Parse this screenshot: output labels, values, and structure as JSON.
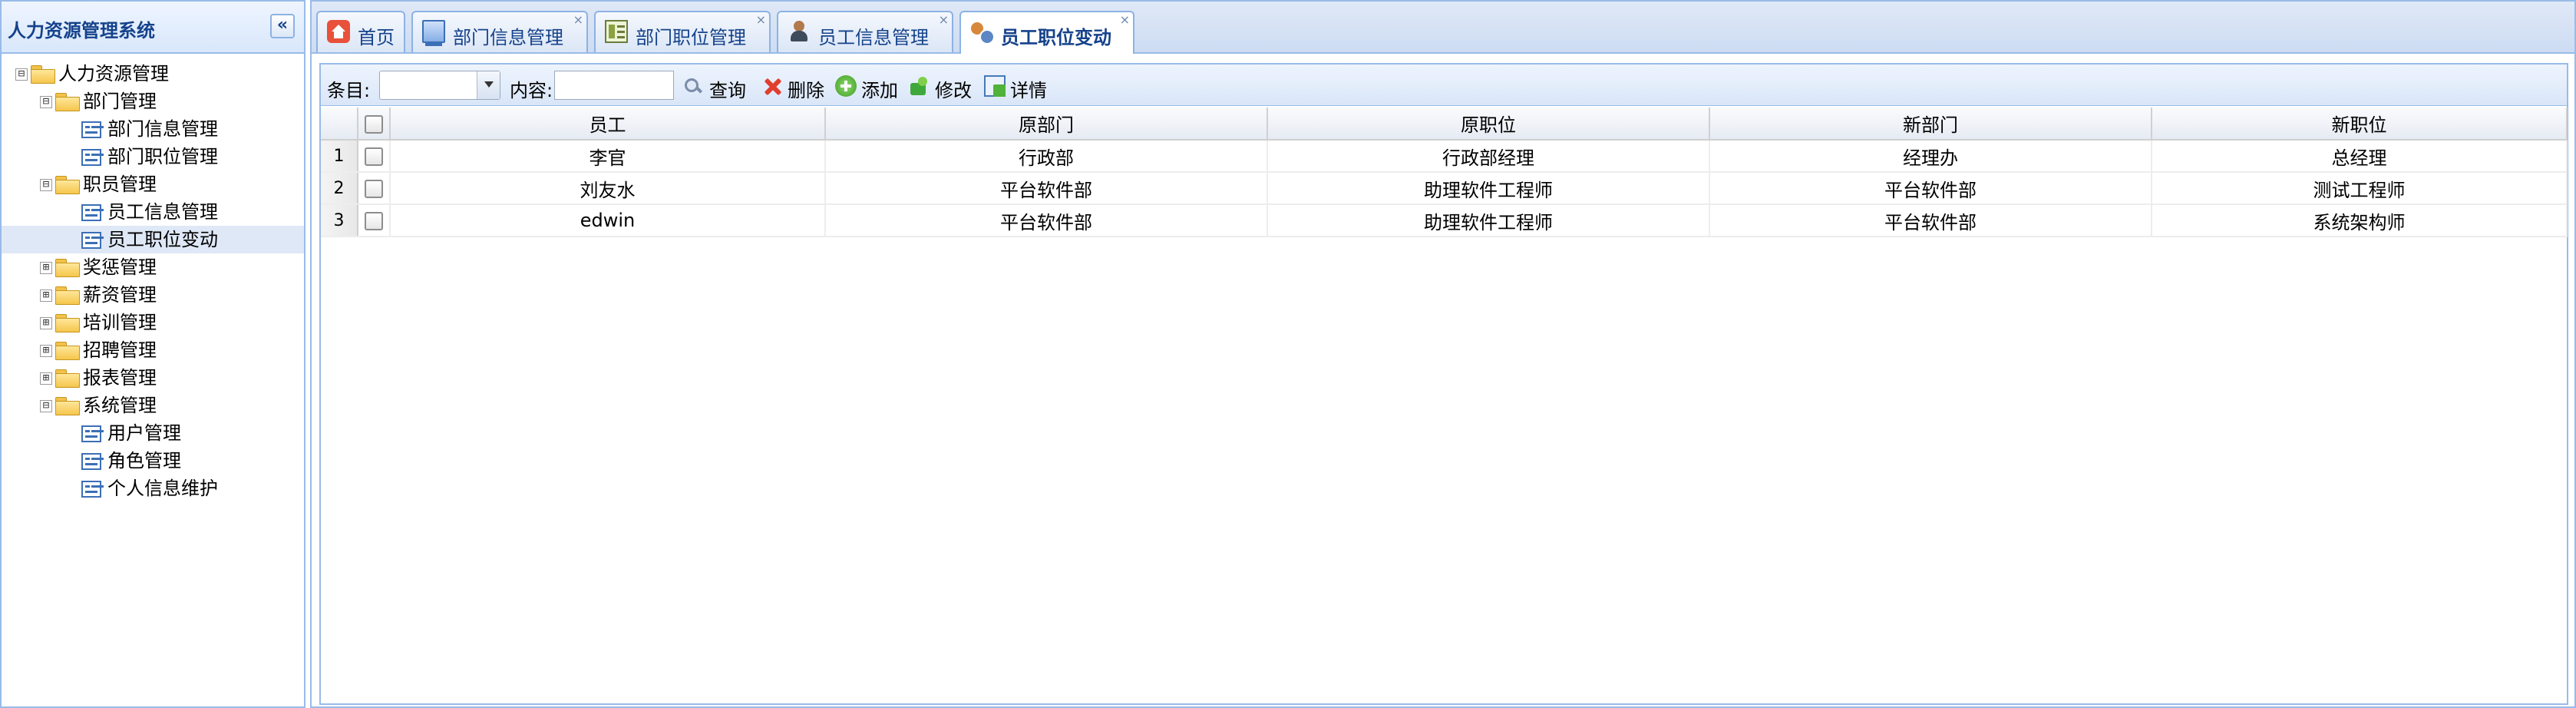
{
  "west": {
    "title": "人力资源管理系统",
    "collapse_glyph": "«"
  },
  "tree": [
    {
      "label": "人力资源管理",
      "toggle": "⊟",
      "type": "folder",
      "level": 0
    },
    {
      "label": "部门管理",
      "toggle": "⊟",
      "type": "folder",
      "level": 1
    },
    {
      "label": "部门信息管理",
      "type": "leaf",
      "level": 2
    },
    {
      "label": "部门职位管理",
      "type": "leaf",
      "level": 2
    },
    {
      "label": "职员管理",
      "toggle": "⊟",
      "type": "folder",
      "level": 1
    },
    {
      "label": "员工信息管理",
      "type": "leaf",
      "level": 2
    },
    {
      "label": "员工职位变动",
      "type": "leaf",
      "level": 2,
      "selected": true
    },
    {
      "label": "奖惩管理",
      "toggle": "⊞",
      "type": "folder",
      "level": 1
    },
    {
      "label": "薪资管理",
      "toggle": "⊞",
      "type": "folder",
      "level": 1
    },
    {
      "label": "培训管理",
      "toggle": "⊞",
      "type": "folder",
      "level": 1
    },
    {
      "label": "招聘管理",
      "toggle": "⊞",
      "type": "folder",
      "level": 1
    },
    {
      "label": "报表管理",
      "toggle": "⊞",
      "type": "folder",
      "level": 1
    },
    {
      "label": "系统管理",
      "toggle": "⊟",
      "type": "folder",
      "level": 1
    },
    {
      "label": "用户管理",
      "type": "leaf",
      "level": 2
    },
    {
      "label": "角色管理",
      "type": "leaf",
      "level": 2
    },
    {
      "label": "个人信息维护",
      "type": "leaf",
      "level": 2
    }
  ],
  "tabs": [
    {
      "label": "首页",
      "icon": "home-icon",
      "closable": false
    },
    {
      "label": "部门信息管理",
      "icon": "department-icon",
      "closable": true
    },
    {
      "label": "部门职位管理",
      "icon": "position-icon",
      "closable": true
    },
    {
      "label": "员工信息管理",
      "icon": "employee-icon",
      "closable": true
    },
    {
      "label": "员工职位变动",
      "icon": "position-change-icon",
      "closable": true,
      "active": true
    }
  ],
  "tab_close_glyph": "×",
  "toolbar": {
    "field_label": "条目:",
    "field_value": "",
    "content_label": "内容:",
    "content_value": "",
    "search_label": "查询",
    "delete_label": "删除",
    "add_label": "添加",
    "edit_label": "修改",
    "detail_label": "详情"
  },
  "grid": {
    "columns": [
      "员工",
      "原部门",
      "原职位",
      "新部门",
      "新职位"
    ],
    "rows": [
      {
        "num": "1",
        "cells": [
          "李官",
          "行政部",
          "行政部经理",
          "经理办",
          "总经理"
        ]
      },
      {
        "num": "2",
        "cells": [
          "刘友水",
          "平台软件部",
          "助理软件工程师",
          "平台软件部",
          "测试工程师"
        ]
      },
      {
        "num": "3",
        "cells": [
          "edwin",
          "平台软件部",
          "助理软件工程师",
          "平台软件部",
          "系统架构师"
        ]
      }
    ]
  },
  "colors": {
    "border": "#99bbe8",
    "title_text": "#15428b",
    "selected_row": "#dfe8f6"
  }
}
